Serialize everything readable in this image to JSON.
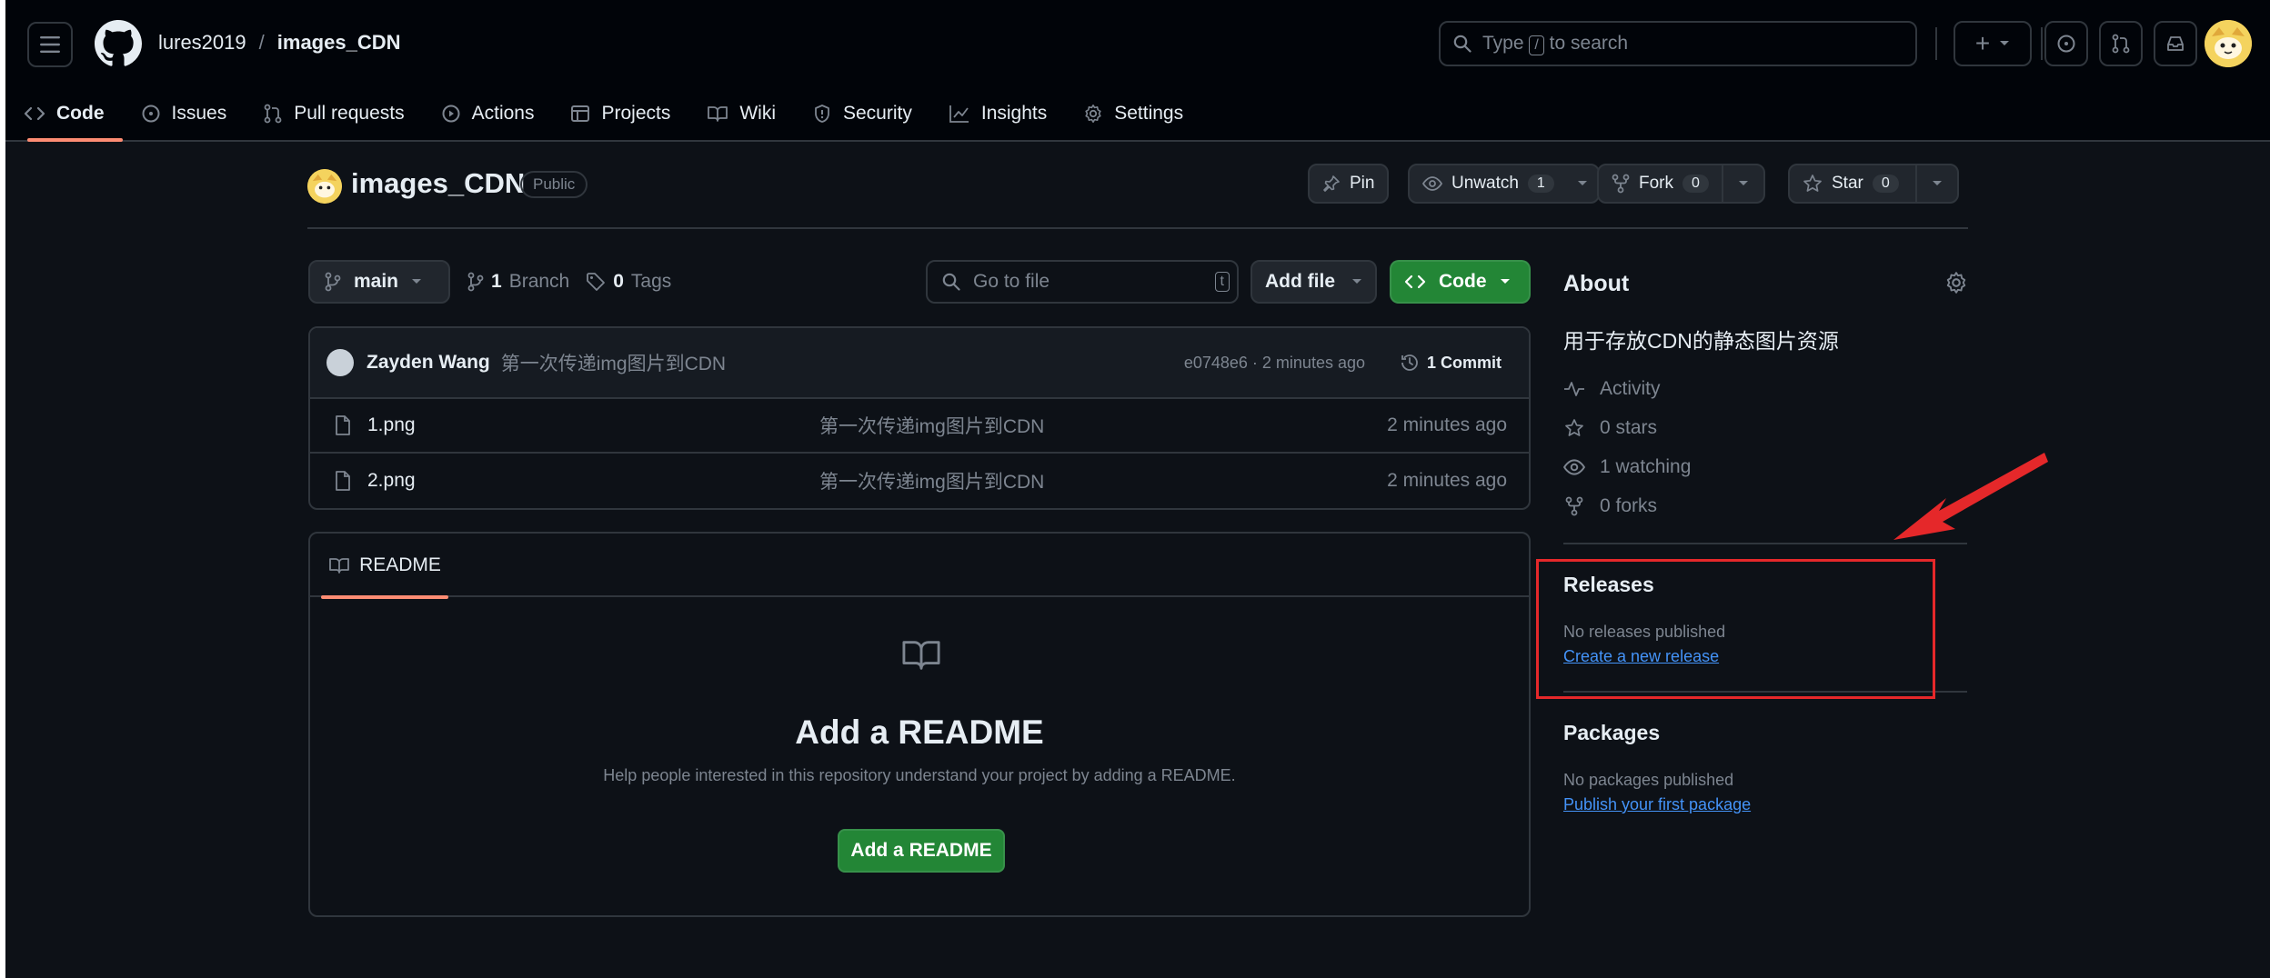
{
  "header": {
    "owner": "lures2019",
    "separator": "/",
    "repo": "images_CDN",
    "search_prefix": "Type",
    "search_key": "/",
    "search_suffix": "to search",
    "plus_label": "+"
  },
  "tabs": [
    {
      "label": "Code",
      "icon": "code-icon"
    },
    {
      "label": "Issues",
      "icon": "issue-icon"
    },
    {
      "label": "Pull requests",
      "icon": "pull-request-icon"
    },
    {
      "label": "Actions",
      "icon": "play-icon"
    },
    {
      "label": "Projects",
      "icon": "table-icon"
    },
    {
      "label": "Wiki",
      "icon": "book-icon"
    },
    {
      "label": "Security",
      "icon": "shield-icon"
    },
    {
      "label": "Insights",
      "icon": "graph-icon"
    },
    {
      "label": "Settings",
      "icon": "gear-icon"
    }
  ],
  "repo": {
    "title": "images_CDN",
    "visibility": "Public",
    "pin": "Pin",
    "unwatch": "Unwatch",
    "watch_count": "1",
    "fork": "Fork",
    "fork_count": "0",
    "star": "Star",
    "star_count": "0"
  },
  "toolbar": {
    "branch": "main",
    "branch_count": "1",
    "branch_label": "Branch",
    "tag_count": "0",
    "tag_label": "Tags",
    "goto_placeholder": "Go to file",
    "goto_key": "t",
    "add_file": "Add file",
    "code": "Code"
  },
  "commit": {
    "author": "Zayden Wang",
    "message": "第一次传递img图片到CDN",
    "meta": "e0748e6 · 2 minutes ago",
    "count_label": "1 Commit"
  },
  "files": [
    {
      "name": "1.png",
      "message": "第一次传递img图片到CDN",
      "time": "2 minutes ago"
    },
    {
      "name": "2.png",
      "message": "第一次传递img图片到CDN",
      "time": "2 minutes ago"
    }
  ],
  "readme": {
    "tab": "README",
    "heading": "Add a README",
    "text": "Help people interested in this repository understand your project by adding a README.",
    "button": "Add a README"
  },
  "about": {
    "title": "About",
    "description": "用于存放CDN的静态图片资源",
    "activity": "Activity",
    "stars": "0 stars",
    "watching": "1 watching",
    "forks": "0 forks"
  },
  "releases": {
    "title": "Releases",
    "note": "No releases published",
    "link": "Create a new release"
  },
  "packages": {
    "title": "Packages",
    "note": "No packages published",
    "link": "Publish your first package"
  },
  "colors": {
    "background": "#0d1117",
    "accent_tab": "#fd8c73",
    "green": "#238636",
    "link": "#4493f8",
    "annotation_red": "#e5282a"
  }
}
